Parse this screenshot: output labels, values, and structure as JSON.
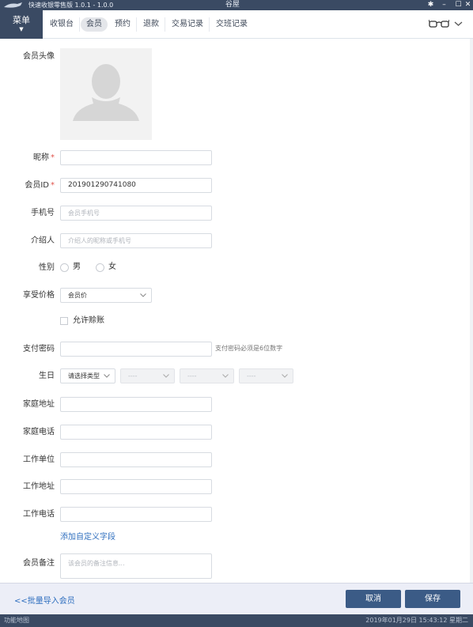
{
  "titlebar": {
    "app_name": "快速收银零售版 1.0.1 - 1.0.0",
    "center_title": "谷屋"
  },
  "nav": {
    "menu_label": "菜单",
    "tabs": [
      {
        "label": "收银台",
        "active": false
      },
      {
        "label": "会员",
        "active": true
      },
      {
        "label": "预约",
        "active": false
      },
      {
        "label": "退款",
        "active": false
      },
      {
        "label": "交易记录",
        "active": false
      },
      {
        "label": "交班记录",
        "active": false
      }
    ]
  },
  "form": {
    "avatar_label": "会员头像",
    "nickname": {
      "label": "昵称",
      "required_mark": "*",
      "value": ""
    },
    "member_id": {
      "label": "会员ID",
      "required_mark": "*",
      "value": "201901290741080"
    },
    "phone": {
      "label": "手机号",
      "placeholder": "会员手机号"
    },
    "referrer": {
      "label": "介绍人",
      "placeholder": "介绍人的昵称或手机号"
    },
    "gender": {
      "label": "性别",
      "options": [
        "男",
        "女"
      ]
    },
    "price": {
      "label": "享受价格",
      "selected": "会员价"
    },
    "allow_credit": {
      "label": "允许赊账",
      "checked": false
    },
    "pay_password": {
      "label": "支付密码",
      "hint": "支付密码必须是6位数字"
    },
    "birthday": {
      "label": "生日",
      "type_selected": "请选择类型",
      "year": "----",
      "month": "----",
      "day": "----"
    },
    "home_address": {
      "label": "家庭地址"
    },
    "home_phone": {
      "label": "家庭电话"
    },
    "work_unit": {
      "label": "工作单位"
    },
    "work_address": {
      "label": "工作地址"
    },
    "work_phone": {
      "label": "工作电话"
    },
    "add_custom_field": "添加自定义字段",
    "remark": {
      "label": "会员备注",
      "placeholder": "该会员的备注信息..."
    }
  },
  "footer": {
    "import_link": "<<批量导入会员",
    "cancel_label": "取消",
    "save_label": "保存"
  },
  "statusbar": {
    "left": "功能地图",
    "right": "2019年01月29日 15:43:12 星期二"
  },
  "colors": {
    "dark": "#3a4a63",
    "button": "#3b5b86",
    "link": "#2f6fbf",
    "required": "#e0524a"
  }
}
